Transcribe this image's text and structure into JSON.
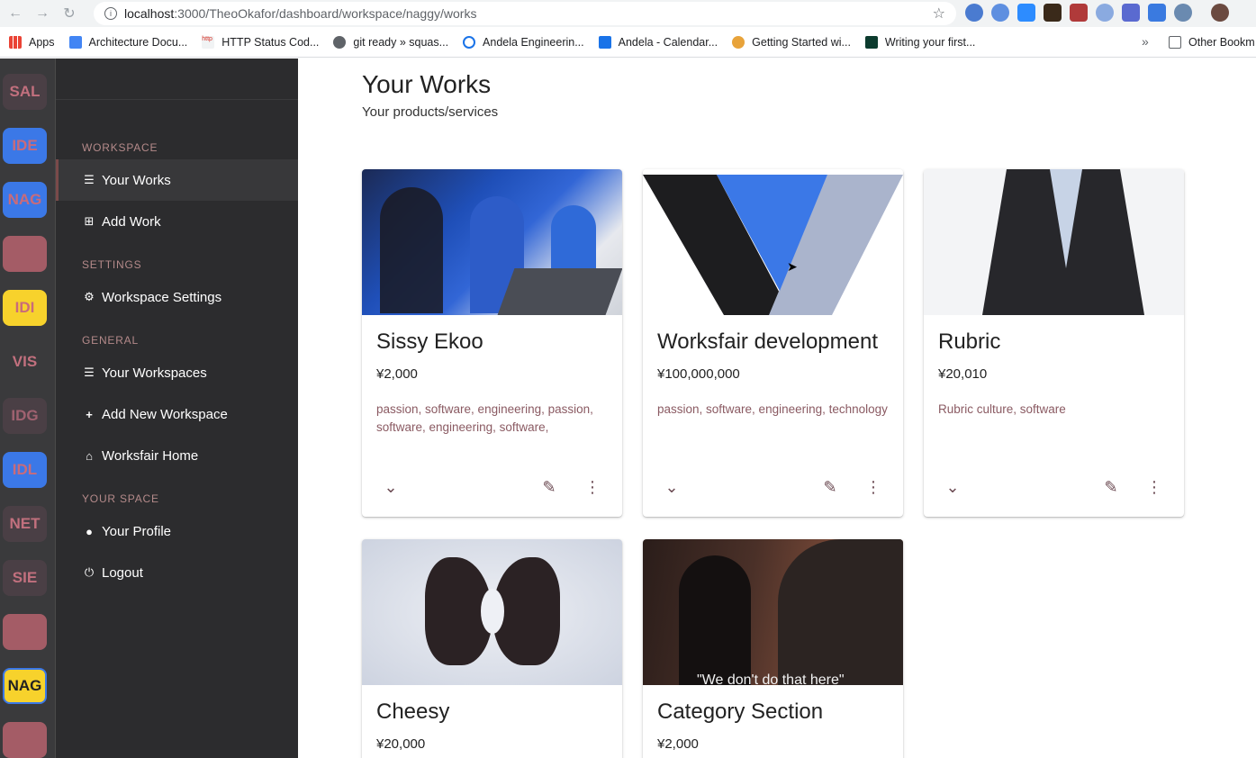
{
  "browser": {
    "url_host": "localhost",
    "url_path": ":3000/TheoOkafor/dashboard/workspace/naggy/works",
    "bookmarks": [
      {
        "label": "Apps",
        "color": "#4285f4"
      },
      {
        "label": "Architecture Docu...",
        "color": "#4285f4"
      },
      {
        "label": "HTTP Status Cod...",
        "color": "#d93025"
      },
      {
        "label": "git ready » squas...",
        "color": "#5f6368"
      },
      {
        "label": "Andela Engineerin...",
        "color": "#1a73e8"
      },
      {
        "label": "Andela - Calendar...",
        "color": "#1a73e8"
      },
      {
        "label": "Getting Started wi...",
        "color": "#e8a33a"
      },
      {
        "label": "Writing your first...",
        "color": "#0c4b33"
      }
    ],
    "bookmarks_more": "»",
    "other_bookmarks": "Other Bookm"
  },
  "rail": {
    "workspaces": [
      {
        "label": "SAL",
        "bg": "#4a3f45",
        "fg": "#c2707e"
      },
      {
        "label": "IDE",
        "bg": "#3b78e7",
        "fg": "#c96b7a"
      },
      {
        "label": "NAG",
        "bg": "#3b78e7",
        "fg": "#c96b7a"
      },
      {
        "label": "",
        "bg": "#a45c66",
        "fg": "#c96b7a"
      },
      {
        "label": "IDI",
        "bg": "#f7d22c",
        "fg": "#c96b7a"
      },
      {
        "label": "VIS",
        "bg": "#3a3a3c",
        "fg": "#c2707e"
      },
      {
        "label": "IDG",
        "bg": "#4a3f45",
        "fg": "#a06270"
      },
      {
        "label": "IDL",
        "bg": "#3b78e7",
        "fg": "#c96b7a"
      },
      {
        "label": "NET",
        "bg": "#4a3f45",
        "fg": "#c2707e"
      },
      {
        "label": "SIE",
        "bg": "#4a3f45",
        "fg": "#c2707e"
      },
      {
        "label": "",
        "bg": "#a45c66",
        "fg": "#c96b7a"
      },
      {
        "label": "NAG",
        "bg": "#f7d22c",
        "fg": "#222222"
      },
      {
        "label": "",
        "bg": "#a45c66",
        "fg": "#c96b7a"
      }
    ]
  },
  "sidebar": {
    "section_workspace": "WORKSPACE",
    "your_works": "Your Works",
    "add_work": "Add Work",
    "section_settings": "SETTINGS",
    "workspace_settings": "Workspace Settings",
    "section_general": "GENERAL",
    "your_workspaces": "Your Workspaces",
    "add_new_workspace": "Add New Workspace",
    "workfair_home": "Worksfair Home",
    "section_your_space": "YOUR SPACE",
    "your_profile": "Your Profile",
    "logout": "Logout"
  },
  "page": {
    "title": "Your Works",
    "subtitle": "Your products/services"
  },
  "cards": [
    {
      "title": "Sissy Ekoo",
      "price": "¥2,000",
      "tags": "passion, software, engineering, passion, software, engineering, software,"
    },
    {
      "title": "Worksfair development",
      "price": "¥100,000,000",
      "tags": "passion, software, engineering, technology"
    },
    {
      "title": "Rubric",
      "price": "¥20,010",
      "tags": "Rubric culture, software"
    },
    {
      "title": "Cheesy",
      "price": "¥20,000",
      "tags": ""
    },
    {
      "title": "Category Section",
      "price": "¥2,000",
      "tags": ""
    }
  ],
  "media_caption": "\"We don't do that here\"",
  "colors": {
    "sidebar_bg": "#2c2c2e",
    "rail_bg": "#3a3a3c",
    "accent_pink": "#b48a8a",
    "tag_text": "#8a5a62",
    "worksfair_blue": "#3b78e7"
  }
}
